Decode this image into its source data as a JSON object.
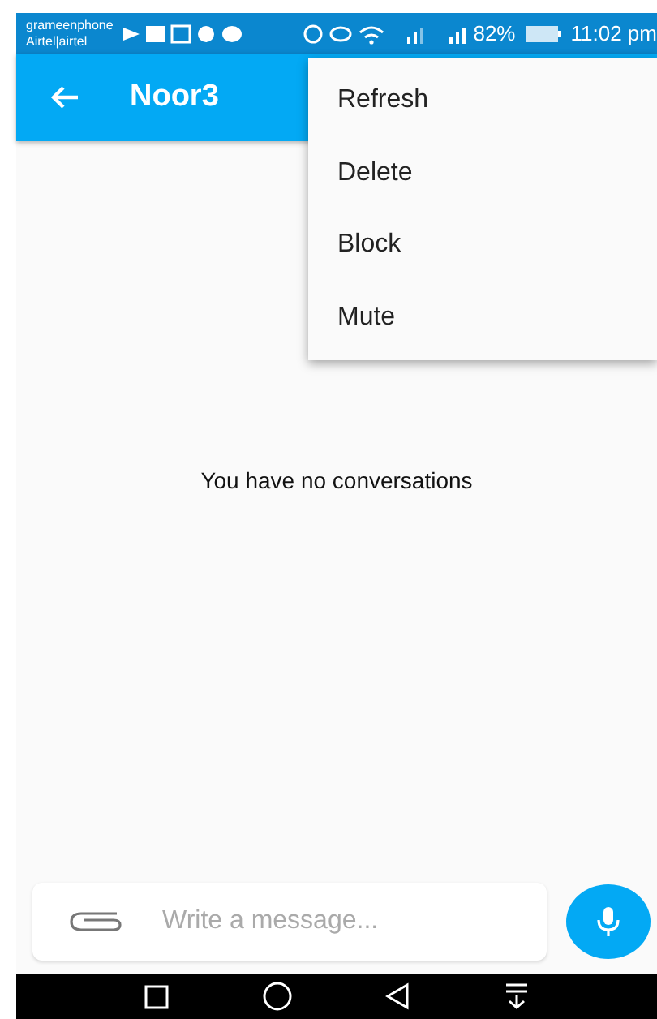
{
  "status_bar": {
    "carriers": [
      "grameenphone",
      "Airtel|airtel"
    ],
    "battery": "82%",
    "time": "11:02 pm"
  },
  "app_bar": {
    "title": "Noor3"
  },
  "menu": {
    "items": [
      {
        "label": "Refresh"
      },
      {
        "label": "Delete"
      },
      {
        "label": "Block"
      },
      {
        "label": "Mute"
      }
    ]
  },
  "empty_message": "You have no conversations",
  "composer": {
    "placeholder": "Write a message..."
  }
}
